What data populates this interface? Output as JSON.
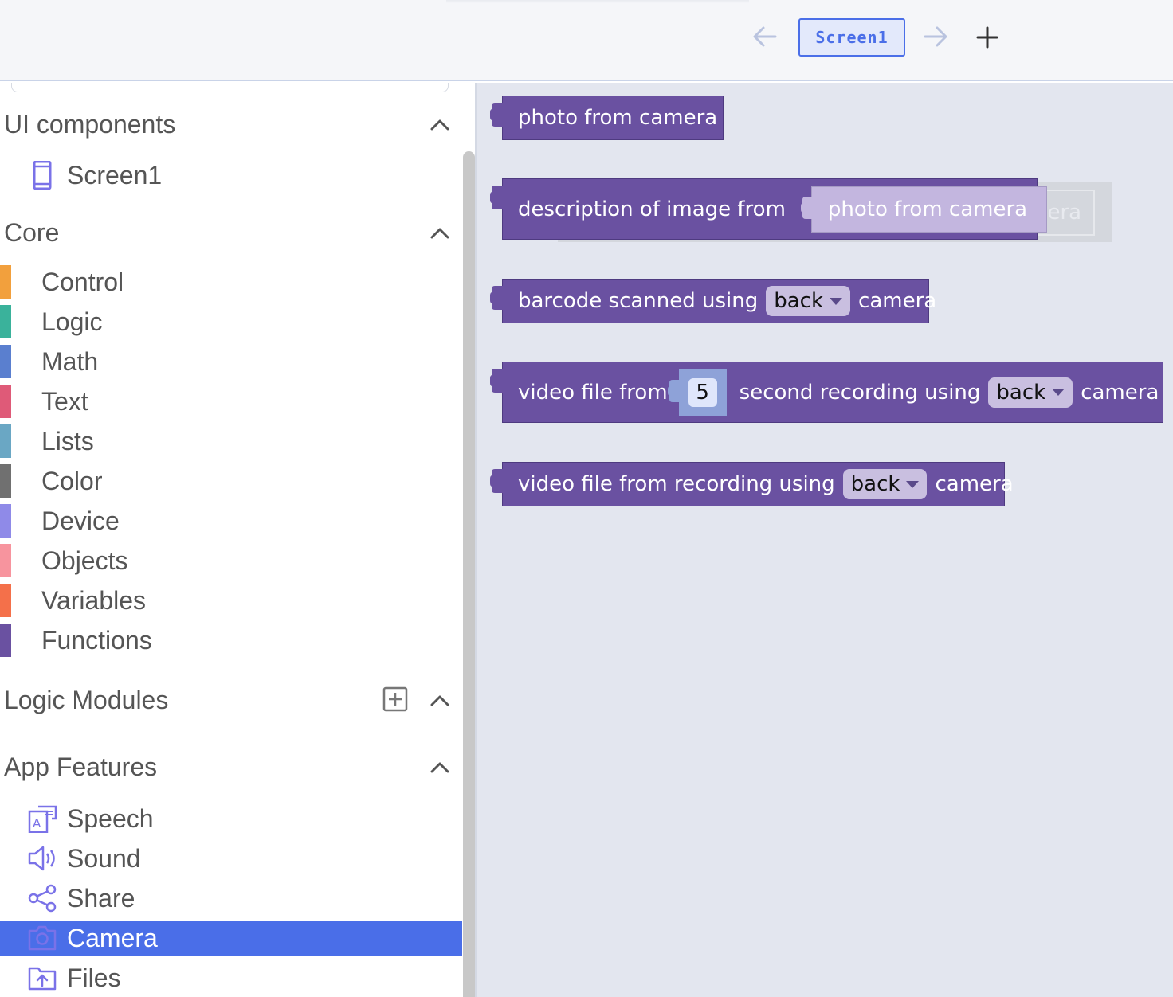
{
  "header": {
    "screen_tab": "Screen1",
    "back_icon": "arrow-left-icon",
    "forward_icon": "arrow-right-icon",
    "add_icon": "plus-icon"
  },
  "sidebar": {
    "ui_components": {
      "title": "UI components",
      "items": [
        {
          "label": "Screen1",
          "icon": "phone-icon"
        }
      ]
    },
    "core": {
      "title": "Core",
      "items": [
        {
          "label": "Control",
          "color": "#f2a03d"
        },
        {
          "label": "Logic",
          "color": "#3ab29b"
        },
        {
          "label": "Math",
          "color": "#5a7fcf"
        },
        {
          "label": "Text",
          "color": "#df5a78"
        },
        {
          "label": "Lists",
          "color": "#6aa7c4"
        },
        {
          "label": "Color",
          "color": "#707070"
        },
        {
          "label": "Device",
          "color": "#8f8ae8"
        },
        {
          "label": "Objects",
          "color": "#f7949e"
        },
        {
          "label": "Variables",
          "color": "#f4704a"
        },
        {
          "label": "Functions",
          "color": "#6a51a1"
        }
      ]
    },
    "logic_modules": {
      "title": "Logic Modules"
    },
    "app_features": {
      "title": "App Features",
      "items": [
        {
          "label": "Speech",
          "icon": "speech-icon"
        },
        {
          "label": "Sound",
          "icon": "speaker-icon"
        },
        {
          "label": "Share",
          "icon": "share-icon"
        },
        {
          "label": "Camera",
          "icon": "camera-icon",
          "selected": true
        },
        {
          "label": "Files",
          "icon": "folder-upload-icon"
        }
      ]
    }
  },
  "workspace": {
    "block_color": "#6a51a1",
    "blocks": {
      "photo": {
        "text": "photo from camera"
      },
      "describe": {
        "text": "description of image from",
        "inner": "photo from camera",
        "ghost_text": "nera"
      },
      "barcode": {
        "pre": "barcode scanned using",
        "dropdown": "back",
        "post": "camera"
      },
      "video_timed": {
        "pre": "video file from",
        "number": "5",
        "mid": "second recording using",
        "dropdown": "back",
        "post": "camera"
      },
      "video": {
        "pre": "video file from recording using",
        "dropdown": "back",
        "post": "camera"
      }
    }
  }
}
